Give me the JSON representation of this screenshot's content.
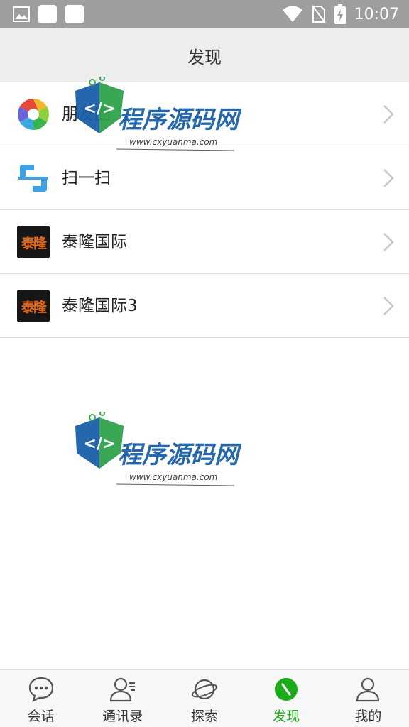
{
  "status_bar": {
    "time": "10:07"
  },
  "header": {
    "title": "发现"
  },
  "list": [
    {
      "label": "朋友圈",
      "icon": "moments-aperture-icon"
    },
    {
      "label": "扫一扫",
      "icon": "scan-icon"
    },
    {
      "label": "泰隆国际",
      "icon": "tailong-app-icon",
      "avatar_text": "泰隆"
    },
    {
      "label": "泰隆国际3",
      "icon": "tailong-app-icon",
      "avatar_text": "泰隆"
    }
  ],
  "watermark": {
    "brand": "程序源码网",
    "url": "www.cxyuanma.com"
  },
  "nav": [
    {
      "label": "会话",
      "icon": "chat-bubble-icon"
    },
    {
      "label": "通讯录",
      "icon": "contacts-icon"
    },
    {
      "label": "探索",
      "icon": "planet-icon"
    },
    {
      "label": "发现",
      "icon": "compass-icon",
      "active": true
    },
    {
      "label": "我的",
      "icon": "person-icon"
    }
  ],
  "colors": {
    "accent": "#1aad19",
    "status_bar": "#9e9e9e",
    "header_bg": "#ededed"
  }
}
